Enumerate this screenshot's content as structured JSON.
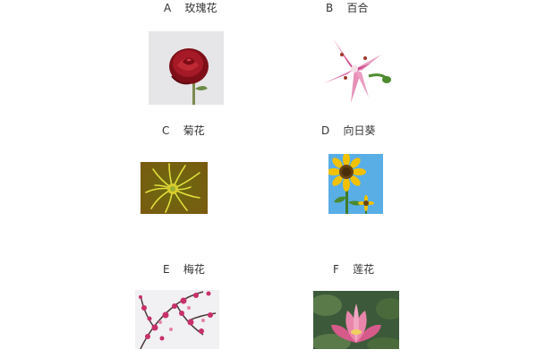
{
  "options": [
    {
      "letter": "A",
      "name": "玫瑰花",
      "image_icon": "red-rose-photo"
    },
    {
      "letter": "B",
      "name": "百合",
      "image_icon": "pink-lily-photo"
    },
    {
      "letter": "C",
      "name": "菊花",
      "image_icon": "yellow-chrysanthemum-photo"
    },
    {
      "letter": "D",
      "name": "向日葵",
      "image_icon": "sunflower-photo"
    },
    {
      "letter": "E",
      "name": "梅花",
      "image_icon": "plum-blossom-photo"
    },
    {
      "letter": "F",
      "name": "莲花",
      "image_icon": "pink-lotus-photo"
    }
  ],
  "colors": {
    "rose_red": "#9c1420",
    "lily_pink": "#d84a8a",
    "chrysanthemum_yellow": "#d8d020",
    "sunflower_yellow": "#f2c200",
    "sky_blue": "#5aaee6",
    "plum_pink": "#c8306a",
    "lotus_pink": "#e06f9b",
    "label_text": "#333333"
  }
}
